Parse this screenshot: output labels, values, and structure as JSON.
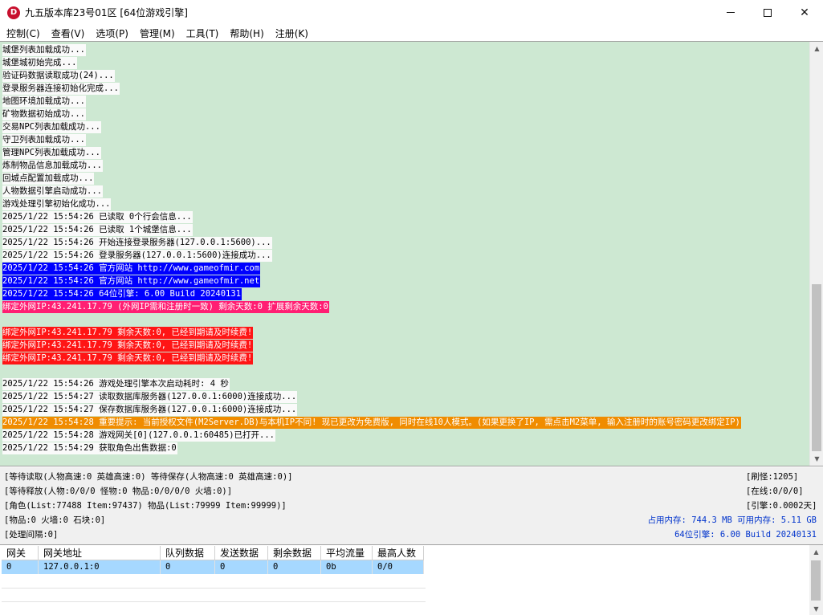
{
  "window": {
    "icon_letter": "D",
    "title": "九五版本库23号01区 [64位游戏引擎]",
    "controls": {
      "minimize": "—",
      "maximize": "□",
      "close": "✕"
    }
  },
  "menu": [
    {
      "label": "控制(C)"
    },
    {
      "label": "查看(V)"
    },
    {
      "label": "选项(P)"
    },
    {
      "label": "管理(M)"
    },
    {
      "label": "工具(T)"
    },
    {
      "label": "帮助(H)"
    },
    {
      "label": "注册(K)"
    }
  ],
  "log": [
    {
      "text": "城堡列表加载成功...",
      "style": "default"
    },
    {
      "text": "城堡城初始完成...",
      "style": "default"
    },
    {
      "text": "验证码数据读取成功(24)...",
      "style": "default"
    },
    {
      "text": "登录服务器连接初始化完成...",
      "style": "default"
    },
    {
      "text": "地图环境加载成功...",
      "style": "default"
    },
    {
      "text": "矿物数据初始成功...",
      "style": "default"
    },
    {
      "text": "交易NPC列表加载成功...",
      "style": "default"
    },
    {
      "text": "守卫列表加载成功...",
      "style": "default"
    },
    {
      "text": "管理NPC列表加载成功...",
      "style": "default"
    },
    {
      "text": "炼制物品信息加载成功...",
      "style": "default"
    },
    {
      "text": "回城点配置加载成功...",
      "style": "default"
    },
    {
      "text": "人物数据引擎启动成功...",
      "style": "default"
    },
    {
      "text": "游戏处理引擎初始化成功...",
      "style": "default"
    },
    {
      "text": "2025/1/22 15:54:26 已读取 0个行会信息...",
      "style": "default"
    },
    {
      "text": "2025/1/22 15:54:26 已读取 1个城堡信息...",
      "style": "default"
    },
    {
      "text": "2025/1/22 15:54:26 开始连接登录服务器(127.0.0.1:5600)...",
      "style": "default"
    },
    {
      "text": "2025/1/22 15:54:26 登录服务器(127.0.0.1:5600)连接成功...",
      "style": "default"
    },
    {
      "text": "2025/1/22 15:54:26 官方网站 http://www.gameofmir.com",
      "style": "blue"
    },
    {
      "text": "2025/1/22 15:54:26 官方网站 http://www.gameofmir.net",
      "style": "blue"
    },
    {
      "text": "2025/1/22 15:54:26 64位引擎: 6.00 Build 20240131",
      "style": "blue"
    },
    {
      "text": "绑定外网IP:43.241.17.79 (外网IP需和注册时一致) 剩余天数:0 扩展剩余天数:0",
      "style": "pink"
    },
    {
      "text": "",
      "style": "blank"
    },
    {
      "text": "绑定外网IP:43.241.17.79 剩余天数:0, 已经到期请及时续费!",
      "style": "red"
    },
    {
      "text": "绑定外网IP:43.241.17.79 剩余天数:0, 已经到期请及时续费!",
      "style": "red"
    },
    {
      "text": "绑定外网IP:43.241.17.79 剩余天数:0, 已经到期请及时续费!",
      "style": "red"
    },
    {
      "text": "",
      "style": "blank"
    },
    {
      "text": "2025/1/22 15:54:26 游戏处理引擎本次启动耗时: 4 秒",
      "style": "default"
    },
    {
      "text": "2025/1/22 15:54:27 读取数据库服务器(127.0.0.1:6000)连接成功...",
      "style": "default"
    },
    {
      "text": "2025/1/22 15:54:27 保存数据库服务器(127.0.0.1:6000)连接成功...",
      "style": "default"
    },
    {
      "text": "2025/1/22 15:54:28 重要提示: 当前授权文件(M2Server.DB)与本机IP不同! 现已更改为免费版, 同时在线10人模式。(如果更换了IP, 需点击M2菜单, 输入注册时的账号密码更改绑定IP)",
      "style": "orange"
    },
    {
      "text": "2025/1/22 15:54:28 游戏网关[0](127.0.0.1:60485)已打开...",
      "style": "default"
    },
    {
      "text": "2025/1/22 15:54:29 获取角色出售数据:0",
      "style": "default"
    }
  ],
  "log_scroll": {
    "up": "▲",
    "down": "▼"
  },
  "status": {
    "line1": "[等待读取(人物高速:0 英雄高速:0) 等待保存(人物高速:0 英雄高速:0)]",
    "line2": "[等待释放(人物:0/0/0 怪物:0 物品:0/0/0/0 火墙:0)]",
    "line3": "[角色(List:77488 Item:97437) 物品(List:79999 Item:99999)]",
    "line4": "[物品:0 火墙:0 石块:0]",
    "line5": "[处理间隔:0]",
    "refresh": "[刷怪:1205]",
    "online": "[在线:0/0/0]",
    "engine_time": "[引擎:0.0002天]",
    "memory": "占用内存: 744.3 MB 可用内存: 5.11 GB",
    "engine_version": "64位引擎: 6.00 Build 20240131",
    "blue_color": "#0033cc"
  },
  "gateway_table": {
    "columns": [
      "网关",
      "网关地址",
      "队列数据",
      "发送数据",
      "剩余数据",
      "平均流量",
      "最高人数"
    ],
    "rows": [
      [
        "0",
        "127.0.0.1:0",
        "0",
        "0",
        "0",
        "0b",
        "0/0"
      ]
    ]
  },
  "table_scroll": {
    "up": "▲",
    "down": "▼"
  }
}
